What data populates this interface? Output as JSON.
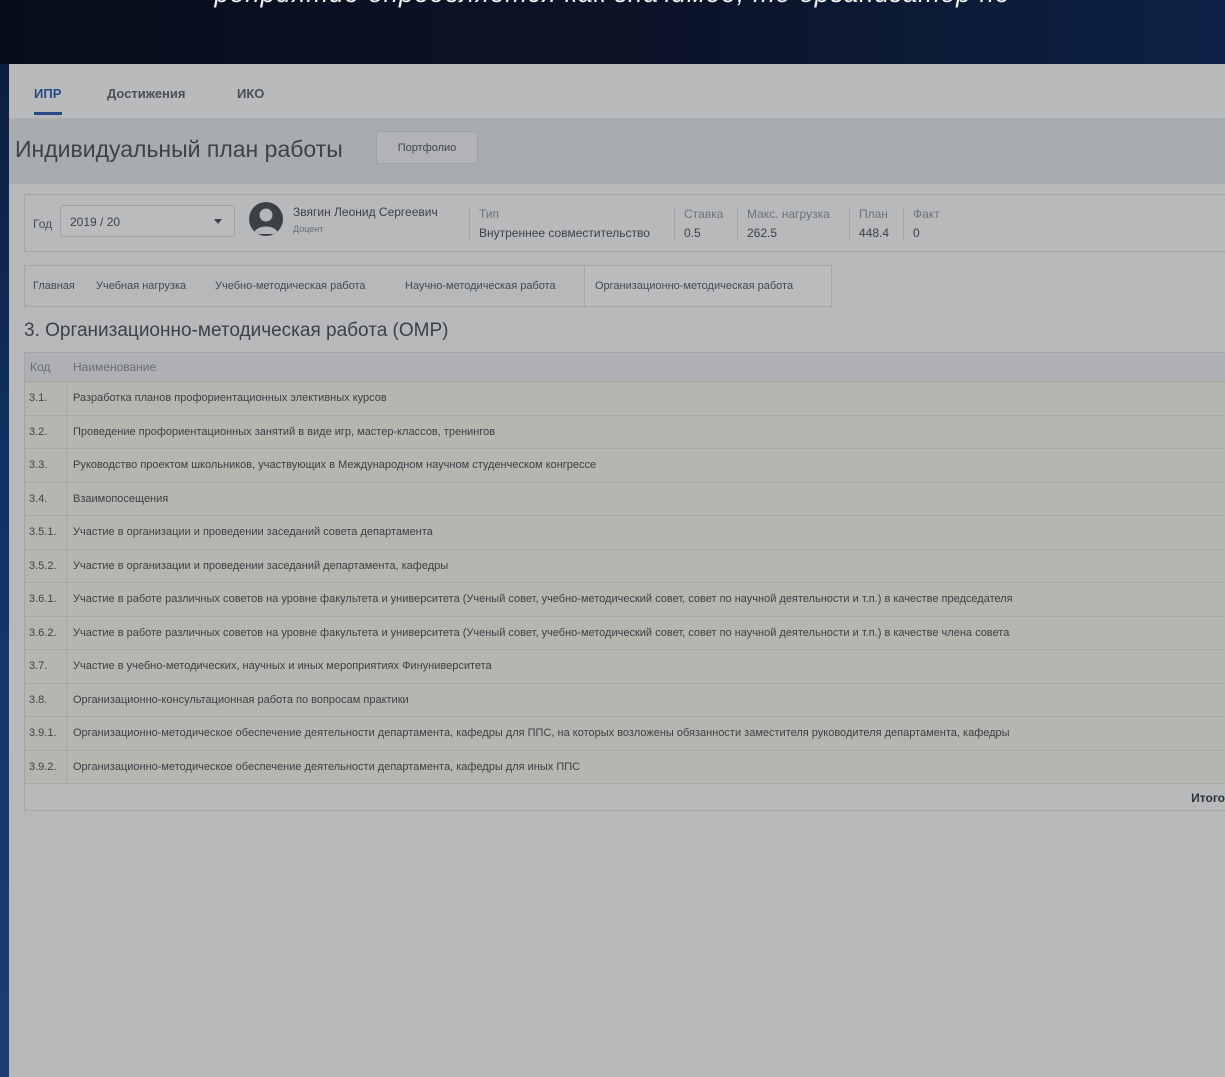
{
  "colors": {
    "accent": "#2a4a87",
    "top_band": "#0b1428"
  },
  "top_caption": "роприятие определяется как значимое, то организатор не",
  "tabs": [
    {
      "label": "ИПР",
      "active": true
    },
    {
      "label": "Достижения",
      "active": false
    },
    {
      "label": "ИКО",
      "active": false
    }
  ],
  "header": {
    "title": "Индивидуальный план работы",
    "portfolio_button": "Портфолио"
  },
  "info": {
    "year_label": "Год",
    "year_value": "2019 / 20",
    "person_name": "Звягин Леонид Сергеевич",
    "person_role": "Доцент",
    "type_caption": "Тип",
    "type_value": "Внутреннее совместительство",
    "rate_caption": "Ставка",
    "rate_value": "0.5",
    "max_caption": "Макс. нагрузка",
    "max_value": "262.5",
    "plan_caption": "План",
    "plan_value": "448.4",
    "fact_caption": "Факт",
    "fact_value": "0"
  },
  "section_tabs": [
    {
      "label": "Главная",
      "active": false
    },
    {
      "label": "Учебная нагрузка",
      "active": false
    },
    {
      "label": "Учебно-методическая работа",
      "active": false
    },
    {
      "label": "Научно-методическая работа",
      "active": false
    },
    {
      "label": "Организационно-методическая работа",
      "active": true
    }
  ],
  "section_heading": "3. Организационно-методическая работа (ОМР)",
  "table": {
    "col_code": "Код",
    "col_name": "Наименование",
    "rows": [
      {
        "code": "3.1.",
        "name": "Разработка планов профориентационных элективных курсов"
      },
      {
        "code": "3.2.",
        "name": "Проведение профориентационных занятий в виде игр, мастер-классов, тренингов"
      },
      {
        "code": "3.3.",
        "name": "Руководство проектом школьников, участвующих в Международном научном студенческом конгрессе"
      },
      {
        "code": "3.4.",
        "name": "Взаимопосещения"
      },
      {
        "code": "3.5.1.",
        "name": "Участие в организации и проведении заседаний совета департамента"
      },
      {
        "code": "3.5.2.",
        "name": "Участие в организации и проведении заседаний департамента, кафедры"
      },
      {
        "code": "3.6.1.",
        "name": "Участие в работе различных советов на уровне факультета и университета (Ученый совет, учебно-методический совет, совет по научной деятельности и т.п.) в качестве председателя"
      },
      {
        "code": "3.6.2.",
        "name": "Участие в работе различных советов на уровне факультета и университета (Ученый совет, учебно-методический совет, совет по научной деятельности и т.п.) в качестве члена совета"
      },
      {
        "code": "3.7.",
        "name": "Участие в учебно-методических, научных и иных мероприятиях Финуниверситета"
      },
      {
        "code": "3.8.",
        "name": "Организационно-консультационная работа по вопросам практики"
      },
      {
        "code": "3.9.1.",
        "name": "Организационно-методическое обеспечение деятельности департамента, кафедры для ППС, на которых возложены обязанности заместителя руководителя департамента, кафедры"
      },
      {
        "code": "3.9.2.",
        "name": "Организационно-методическое обеспечение деятельности департамента, кафедры для иных ППС"
      }
    ],
    "total_label": "Итого"
  }
}
